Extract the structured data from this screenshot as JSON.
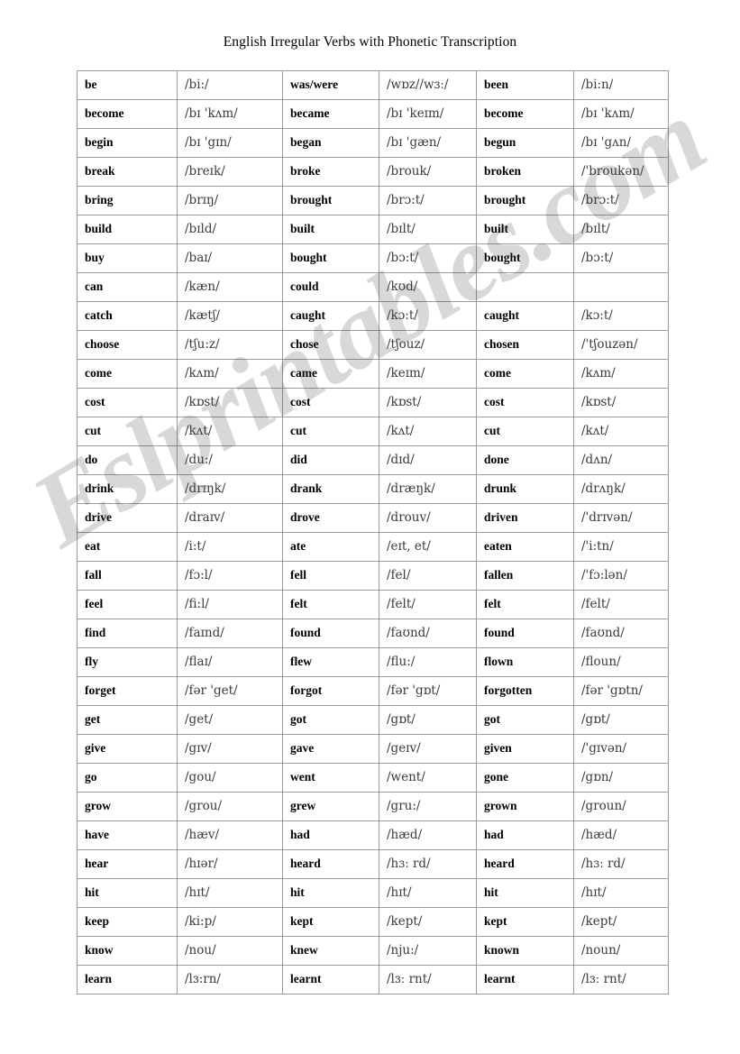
{
  "document": {
    "title": "English Irregular Verbs with Phonetic Transcription",
    "watermark": "Eslprintables.com",
    "background_color": "#ffffff",
    "text_color": "#000000",
    "ipa_color": "#3a3a3a",
    "border_color": "#9b9b9b"
  },
  "table": {
    "column_count": 6,
    "row_count": 30,
    "column_roles": [
      "infinitive",
      "infinitive-ipa",
      "past-simple",
      "past-simple-ipa",
      "past-participle",
      "past-participle-ipa"
    ],
    "rows": [
      [
        "be",
        "/bi:/",
        "was/were",
        "/wɒz//wɜː/",
        "been",
        "/bi:n/"
      ],
      [
        "become",
        "/bɪ 'kʌm/",
        "became",
        "/bɪ 'keɪm/",
        "become",
        "/bɪ 'kʌm/"
      ],
      [
        "begin",
        "/bɪ 'gɪn/",
        "began",
        "/bɪ 'gæn/",
        "begun",
        "/bɪ 'gʌn/"
      ],
      [
        "break",
        "/breɪk/",
        "broke",
        "/brouk/",
        "broken",
        "/'broukən/"
      ],
      [
        "bring",
        "/brɪŋ/",
        "brought",
        "/brɔ:t/",
        "brought",
        "/brɔ:t/"
      ],
      [
        "build",
        "/bɪld/",
        "built",
        "/bɪlt/",
        "built",
        "/bɪlt/"
      ],
      [
        "buy",
        "/baɪ/",
        "bought",
        "/bɔ:t/",
        "bought",
        "/bɔ:t/"
      ],
      [
        "can",
        "/kæn/",
        "could",
        "/kʊd/",
        "",
        ""
      ],
      [
        "catch",
        "/kætʃ/",
        "caught",
        "/kɔ:t/",
        "caught",
        "/kɔ:t/"
      ],
      [
        "choose",
        "/tʃu:z/",
        "chose",
        "/tʃouz/",
        "chosen",
        "/'tʃouzən/"
      ],
      [
        "come",
        "/kʌm/",
        "came",
        "/keɪm/",
        "come",
        "/kʌm/"
      ],
      [
        "cost",
        "/kɒst/",
        "cost",
        "/kɒst/",
        "cost",
        "/kɒst/"
      ],
      [
        "cut",
        "/kʌt/",
        "cut",
        "/kʌt/",
        "cut",
        "/kʌt/"
      ],
      [
        "do",
        "/du:/",
        "did",
        "/dɪd/",
        "done",
        "/dʌn/"
      ],
      [
        "drink",
        "/drɪŋk/",
        "drank",
        "/dræŋk/",
        "drunk",
        "/drʌŋk/"
      ],
      [
        "drive",
        "/draɪv/",
        "drove",
        "/drouv/",
        "driven",
        "/'drɪvən/"
      ],
      [
        "eat",
        "/i:t/",
        "ate",
        "/eɪt, et/",
        "eaten",
        "/'i:tn/"
      ],
      [
        "fall",
        "/fɔ:l/",
        "fell",
        "/fel/",
        "fallen",
        "/'fɔ:lən/"
      ],
      [
        "feel",
        "/fi:l/",
        "felt",
        "/felt/",
        "felt",
        "/felt/"
      ],
      [
        "find",
        "/faɪnd/",
        "found",
        "/faʊnd/",
        "found",
        "/faʊnd/"
      ],
      [
        "fly",
        "/flaɪ/",
        "flew",
        "/flu:/",
        "flown",
        "/floun/"
      ],
      [
        "forget",
        "/fər 'get/",
        "forgot",
        "/fər 'gɒt/",
        "forgotten",
        "/fər 'gɒtn/"
      ],
      [
        "get",
        "/get/",
        "got",
        "/gɒt/",
        "got",
        "/gɒt/"
      ],
      [
        "give",
        "/gɪv/",
        "gave",
        "/geɪv/",
        "given",
        "/'gɪvən/"
      ],
      [
        "go",
        "/gou/",
        "went",
        "/went/",
        "gone",
        "/gɒn/"
      ],
      [
        "grow",
        "/grou/",
        "grew",
        "/gru:/",
        "grown",
        "/groun/"
      ],
      [
        "have",
        "/hæv/",
        "had",
        "/hæd/",
        "had",
        "/hæd/"
      ],
      [
        "hear",
        "/hɪər/",
        "heard",
        "/hɜː rd/",
        "heard",
        "/hɜː rd/"
      ],
      [
        "hit",
        "/hɪt/",
        "hit",
        "/hɪt/",
        "hit",
        "/hɪt/"
      ],
      [
        "keep",
        "/ki:p/",
        "kept",
        "/kept/",
        "kept",
        "/kept/"
      ],
      [
        "know",
        "/nou/",
        "knew",
        "/nju:/",
        "known",
        "/noun/"
      ],
      [
        "learn",
        "/lɜ:rn/",
        "learnt",
        "/lɜː rnt/",
        "learnt",
        "/lɜː rnt/"
      ]
    ]
  }
}
